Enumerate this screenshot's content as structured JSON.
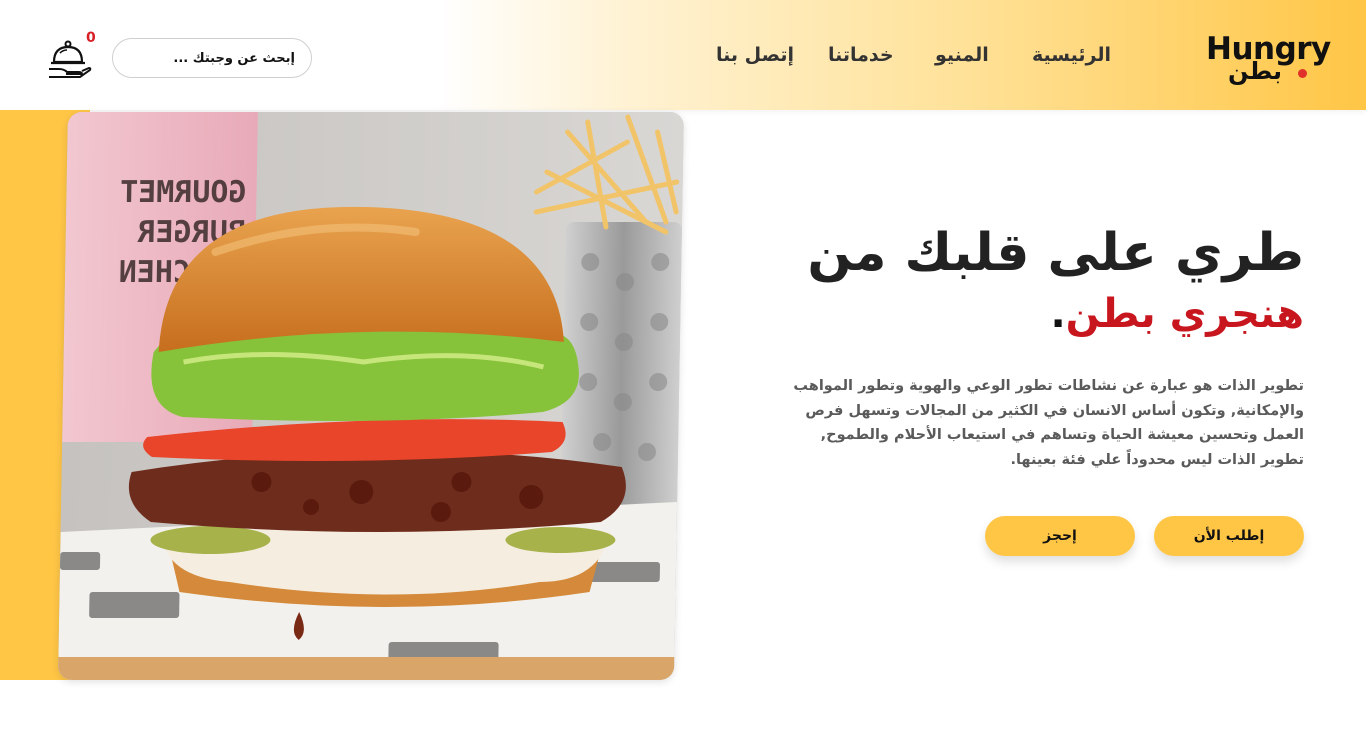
{
  "brand": {
    "name_en": "Hungry",
    "name_ar": "بطن"
  },
  "nav": {
    "home": "الرئيسية",
    "menu": "المنيو",
    "services": "خدماتنا",
    "contact": "إتصل بنا"
  },
  "search": {
    "placeholder": "إبحث عن وجبتك ..."
  },
  "cart": {
    "count": "0",
    "icon": "cloche-hand-icon"
  },
  "hero": {
    "title": "طري على قلبك من",
    "subtitle": "هنجري بطن",
    "subtitle_dot": ".",
    "description": "تطوير الذات هو عبارة عن نشاطات تطور الوعي والهوية وتطور المواهب والإمكانية, وتكون أساس الانسان في الكثير من المجالات وتسهل فرص العمل وتحسين معيشة الحياة وتساهم في استيعاب الأحلام والطموح, تطوير الذات ليس محدوداً علي فئة بعينها.",
    "order_button": "إطلب الأن",
    "reserve_button": "إحجز",
    "image": "burger-photo"
  },
  "colors": {
    "accent": "#ffc646",
    "brand_red": "#c8161e",
    "text_dark": "#222222"
  }
}
